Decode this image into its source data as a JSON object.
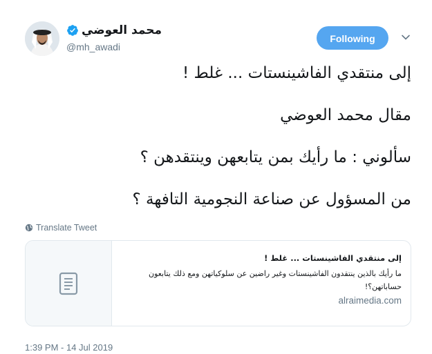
{
  "author": {
    "display_name": "محمد العوضي",
    "handle": "@mh_awadi",
    "verified": true
  },
  "follow_button": {
    "label": "Following",
    "color": "#55a6f0"
  },
  "tweet": {
    "lines": [
      "إلى منتقدي الفاشينستات ... غلط !",
      "مقال محمد العوضي",
      "سألوني : ما رأيك بمن يتابعهن وينتقدهن ؟",
      "من المسؤول عن صناعة النجومية التافهة ؟"
    ]
  },
  "translate": {
    "label": "Translate Tweet",
    "icon": "globe-icon"
  },
  "link_card": {
    "thumbnail_icon": "document-icon",
    "title": "إلى منتقدي الفاشينستات ... غلط !",
    "description": "ما رأيك بالذين ينتقدون الفاشينستات وغير راضين عن سلوكياتهن ومع ذلك يتابعون حساباتهن؟!",
    "domain": "alraimedia.com"
  },
  "timestamp": "1:39 PM - 14 Jul 2019",
  "colors": {
    "link_blue": "#1da1f2",
    "secondary_text": "#657786",
    "border": "#e1e8ed"
  }
}
